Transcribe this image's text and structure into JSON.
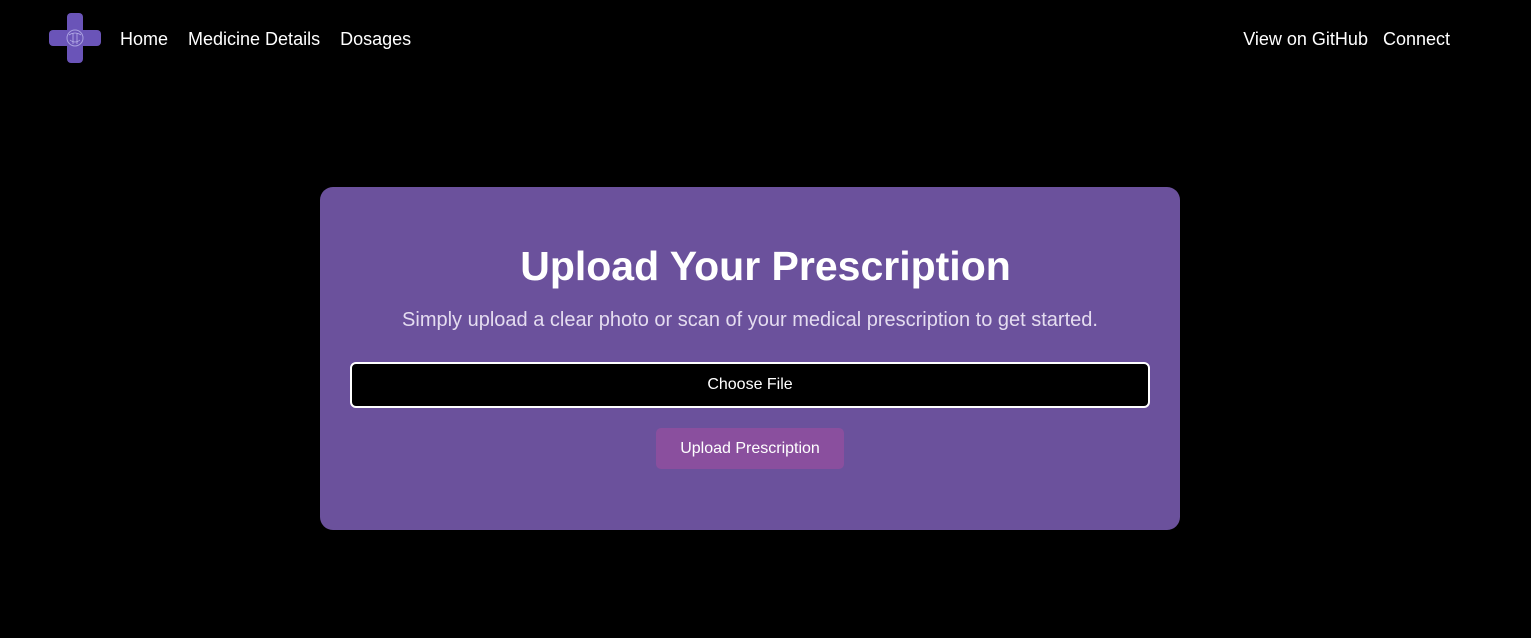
{
  "nav": {
    "left": [
      {
        "label": "Home"
      },
      {
        "label": "Medicine Details"
      },
      {
        "label": "Dosages"
      }
    ],
    "right": [
      {
        "label": "View on GitHub"
      },
      {
        "label": "Connect"
      }
    ],
    "logo_icon": "medical-cross-logo"
  },
  "main": {
    "title": "Upload Your Prescription",
    "subtitle": "Simply upload a clear photo or scan of your medical prescription to get started.",
    "file_input_label": "Choose File",
    "upload_button_label": "Upload Prescription"
  },
  "colors": {
    "background": "#000000",
    "card": "#6b519c",
    "button": "#8a4f9e",
    "logo": "#6a54b8"
  }
}
